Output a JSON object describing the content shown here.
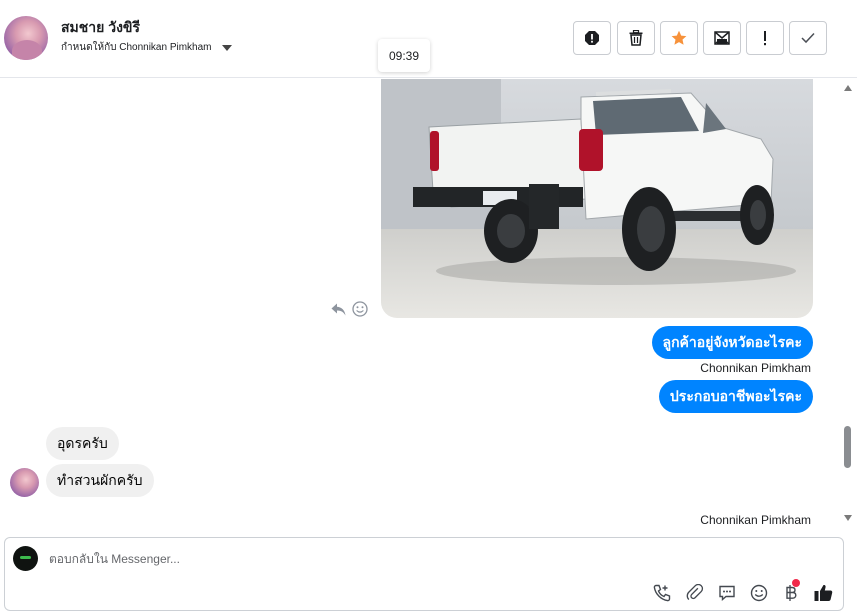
{
  "header": {
    "contact_name": "สมชาย วังขิรี",
    "assigned_text": "กำหนดให้กับ Chonnikan Pimkham",
    "timestamp_tooltip": "09:39",
    "toolbar": [
      {
        "icon": "spam-report-icon"
      },
      {
        "icon": "trash-icon"
      },
      {
        "icon": "star-icon",
        "color": "#f7923b"
      },
      {
        "icon": "mark-unread-icon"
      },
      {
        "icon": "important-icon"
      },
      {
        "icon": "done-check-icon"
      }
    ]
  },
  "messages": [
    {
      "direction": "outgoing",
      "type": "image",
      "image": "white-pickup-truck-photo"
    },
    {
      "direction": "outgoing",
      "type": "text",
      "text": "ลูกค้าอยู่จังหวัดอะไรคะ"
    },
    {
      "direction": "outgoing",
      "type": "sender",
      "text": "Chonnikan Pimkham"
    },
    {
      "direction": "outgoing",
      "type": "text",
      "text": "ประกอบอาชีพอะไรคะ"
    },
    {
      "direction": "incoming",
      "type": "text",
      "text": "อุดรครับ"
    },
    {
      "direction": "incoming",
      "type": "text",
      "text": "ทำสวนผักครับ"
    },
    {
      "direction": "outgoing",
      "type": "sender",
      "text": "Chonnikan Pimkham"
    }
  ],
  "composer": {
    "placeholder": "ตอบกลับใน Messenger...",
    "icons": [
      "call-icon",
      "attachment-icon",
      "saved-reply-icon",
      "emoji-icon",
      "payment-baht-icon",
      "like-thumb-icon"
    ]
  },
  "colors": {
    "outgoing_bubble": "#0084ff",
    "incoming_bubble": "#f0f0f0",
    "accent_star": "#f7923b",
    "notification_dot": "#f02849"
  }
}
